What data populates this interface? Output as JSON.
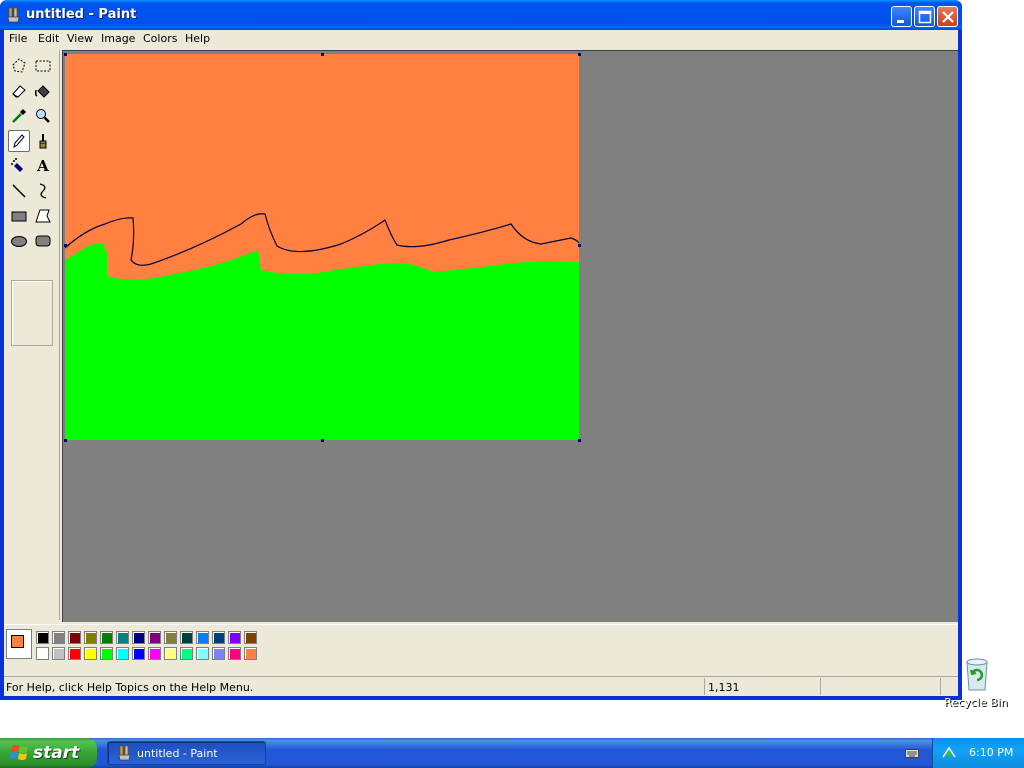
{
  "window": {
    "title": "untitled - Paint",
    "controls": {
      "minimize": "minimize",
      "maximize": "maximize",
      "close": "close"
    }
  },
  "menu": [
    "File",
    "Edit",
    "View",
    "Image",
    "Colors",
    "Help"
  ],
  "tools": [
    "free-form-select",
    "rect-select",
    "eraser",
    "fill-with-color",
    "pick-color",
    "magnifier",
    "pencil",
    "brush",
    "airbrush",
    "text",
    "line",
    "curve",
    "rectangle",
    "polygon",
    "ellipse",
    "rounded-rectangle"
  ],
  "active_tool": "pencil",
  "canvas": {
    "sky_color": "#ff8040",
    "ground_color": "#00ff00",
    "line_color": "#000040"
  },
  "colors": {
    "foreground": "#ff8040",
    "background": "#ffffff",
    "palette_top": [
      "#000000",
      "#808080",
      "#800000",
      "#808000",
      "#008000",
      "#008080",
      "#000080",
      "#800080",
      "#808040",
      "#004040",
      "#0080ff",
      "#004080",
      "#8000ff",
      "#804000"
    ],
    "palette_bottom": [
      "#ffffff",
      "#c0c0c0",
      "#ff0000",
      "#ffff00",
      "#00ff00",
      "#00ffff",
      "#0000ff",
      "#ff00ff",
      "#ffff80",
      "#00ff80",
      "#80ffff",
      "#8080ff",
      "#ff0080",
      "#ff8040"
    ]
  },
  "status": {
    "help_text": "For Help, click Help Topics on the Help Menu.",
    "coords": "1,131"
  },
  "desktop": {
    "recycle_bin_label": "Recycle Bin"
  },
  "taskbar": {
    "start_label": "start",
    "task_label": "untitled - Paint",
    "clock": "6:10 PM"
  }
}
